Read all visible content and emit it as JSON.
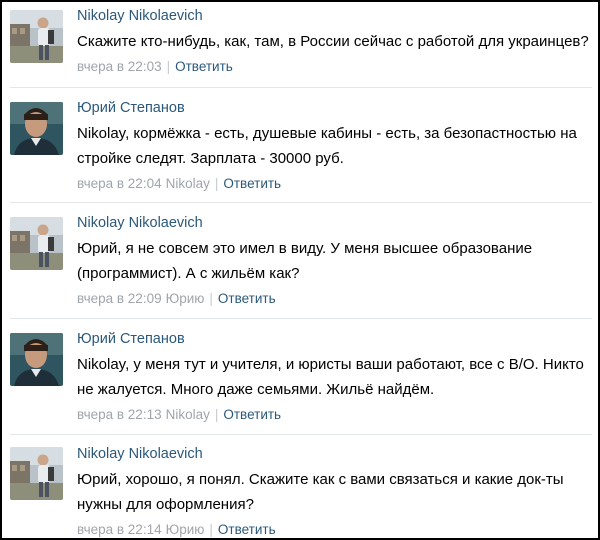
{
  "comments": [
    {
      "author": "Nikolay Nikolaevich",
      "avatar": "avatar-nikolay",
      "text": "Скажите кто-нибудь, как, там, в России сейчас с работой для украинцев?",
      "time": "вчера в 22:03",
      "reply_to": "",
      "reply_label": "Ответить"
    },
    {
      "author": "Юрий Степанов",
      "avatar": "avatar-yuriy",
      "text": "Nikolay, кормёжка - есть, душевые кабины - есть, за безопастностью на стройке следят. Зарплата - 30000 руб.",
      "time": "вчера в 22:04",
      "reply_to": "Nikolay",
      "reply_label": "Ответить"
    },
    {
      "author": "Nikolay Nikolaevich",
      "avatar": "avatar-nikolay",
      "text": "Юрий, я не совсем это имел в виду. У меня высшее образование (программист). А с жильём как?",
      "time": "вчера в 22:09",
      "reply_to": "Юрию",
      "reply_label": "Ответить"
    },
    {
      "author": "Юрий Степанов",
      "avatar": "avatar-yuriy",
      "text": "Nikolay, у меня тут и учителя, и юристы ваши работают, все с В/О. Никто не жалуется. Много даже семьями. Жильё найдём.",
      "time": "вчера в 22:13",
      "reply_to": "Nikolay",
      "reply_label": "Ответить"
    },
    {
      "author": "Nikolay Nikolaevich",
      "avatar": "avatar-nikolay",
      "text": "Юрий, хорошо, я понял. Скажите как с вами связаться и какие док-ты нужны для оформления?",
      "time": "вчера в 22:14",
      "reply_to": "Юрию",
      "reply_label": "Ответить"
    }
  ],
  "colors": {
    "author": "#2b587a",
    "meta": "#a0a5ab",
    "divider": "#e3e6ea"
  }
}
